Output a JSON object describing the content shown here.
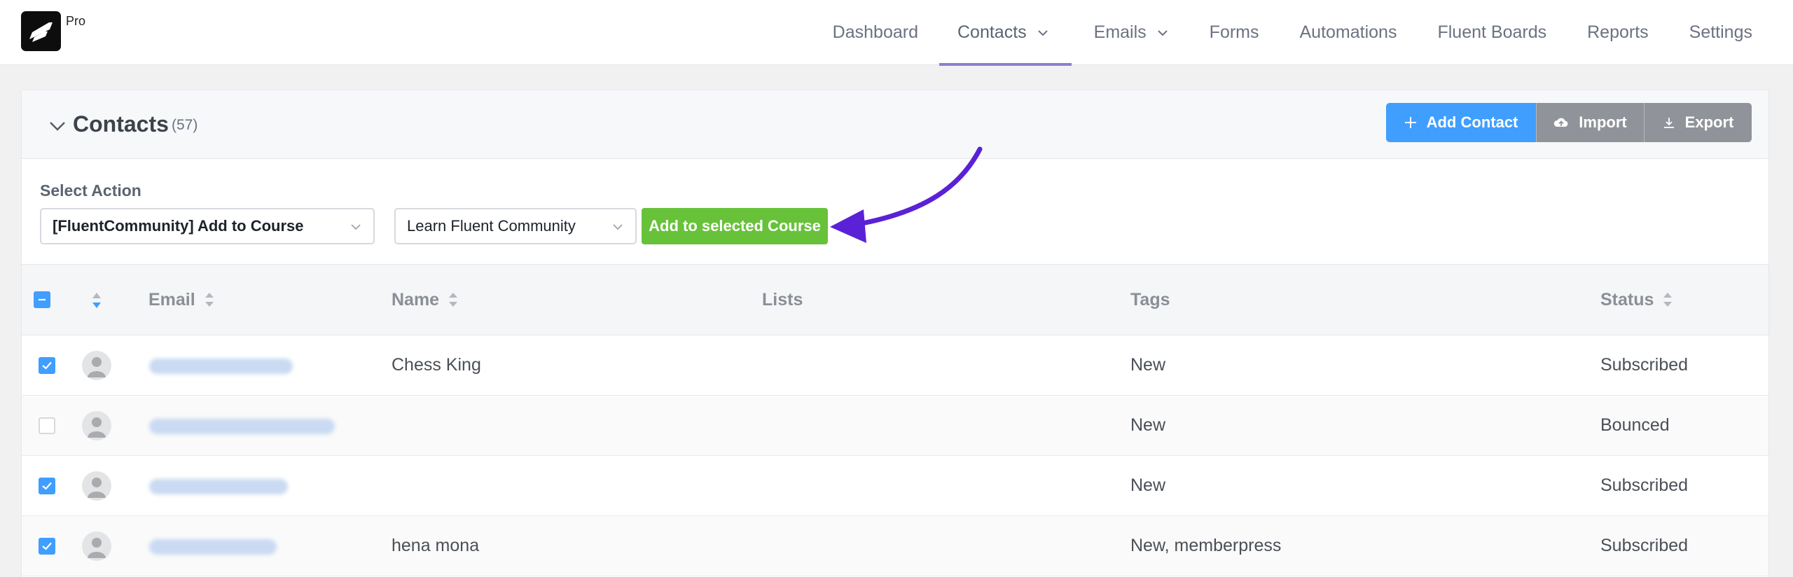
{
  "app": {
    "badge": "Pro"
  },
  "nav": {
    "items": [
      {
        "label": "Dashboard",
        "dropdown": false,
        "active": false
      },
      {
        "label": "Contacts",
        "dropdown": true,
        "active": true
      },
      {
        "label": "Emails",
        "dropdown": true,
        "active": false
      },
      {
        "label": "Forms",
        "dropdown": false,
        "active": false
      },
      {
        "label": "Automations",
        "dropdown": false,
        "active": false
      },
      {
        "label": "Fluent Boards",
        "dropdown": false,
        "active": false
      },
      {
        "label": "Reports",
        "dropdown": false,
        "active": false
      },
      {
        "label": "Settings",
        "dropdown": false,
        "active": false
      }
    ]
  },
  "contacts": {
    "title": "Contacts",
    "count": "(57)",
    "buttons": {
      "add": "Add Contact",
      "import": "Import",
      "export": "Export"
    }
  },
  "bulk_action": {
    "label": "Select Action",
    "action_value": "[FluentCommunity] Add to Course",
    "course_value": "Learn Fluent Community",
    "apply": "Add to selected Course"
  },
  "table": {
    "columns": {
      "email": "Email",
      "name": "Name",
      "lists": "Lists",
      "tags": "Tags",
      "status": "Status"
    },
    "rows": [
      {
        "checked": true,
        "name": "Chess King",
        "lists": "",
        "tags": "New",
        "status": "Subscribed"
      },
      {
        "checked": false,
        "name": "",
        "lists": "",
        "tags": "New",
        "status": "Bounced"
      },
      {
        "checked": true,
        "name": "",
        "lists": "",
        "tags": "New",
        "status": "Subscribed"
      },
      {
        "checked": true,
        "name": "hena mona",
        "lists": "",
        "tags": "New, memberpress",
        "status": "Subscribed"
      }
    ]
  },
  "colors": {
    "primary": "#409eff",
    "success": "#67c23a",
    "neutral_button": "#909399",
    "annotation_arrow": "#5b21d6"
  }
}
